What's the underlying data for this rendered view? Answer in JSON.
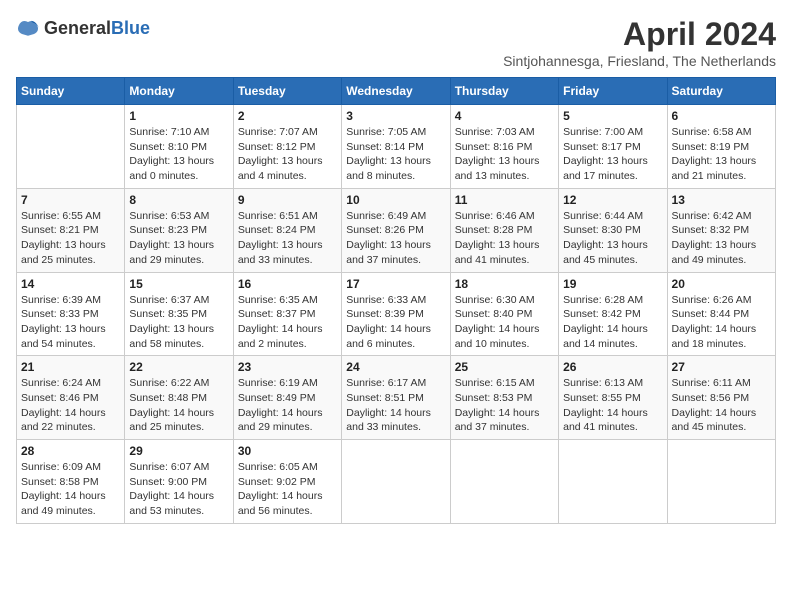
{
  "header": {
    "logo_general": "General",
    "logo_blue": "Blue",
    "month_year": "April 2024",
    "location": "Sintjohannesga, Friesland, The Netherlands"
  },
  "days_of_week": [
    "Sunday",
    "Monday",
    "Tuesday",
    "Wednesday",
    "Thursday",
    "Friday",
    "Saturday"
  ],
  "weeks": [
    [
      {
        "day": null,
        "info": null
      },
      {
        "day": "1",
        "info": "Sunrise: 7:10 AM\nSunset: 8:10 PM\nDaylight: 13 hours\nand 0 minutes."
      },
      {
        "day": "2",
        "info": "Sunrise: 7:07 AM\nSunset: 8:12 PM\nDaylight: 13 hours\nand 4 minutes."
      },
      {
        "day": "3",
        "info": "Sunrise: 7:05 AM\nSunset: 8:14 PM\nDaylight: 13 hours\nand 8 minutes."
      },
      {
        "day": "4",
        "info": "Sunrise: 7:03 AM\nSunset: 8:16 PM\nDaylight: 13 hours\nand 13 minutes."
      },
      {
        "day": "5",
        "info": "Sunrise: 7:00 AM\nSunset: 8:17 PM\nDaylight: 13 hours\nand 17 minutes."
      },
      {
        "day": "6",
        "info": "Sunrise: 6:58 AM\nSunset: 8:19 PM\nDaylight: 13 hours\nand 21 minutes."
      }
    ],
    [
      {
        "day": "7",
        "info": "Sunrise: 6:55 AM\nSunset: 8:21 PM\nDaylight: 13 hours\nand 25 minutes."
      },
      {
        "day": "8",
        "info": "Sunrise: 6:53 AM\nSunset: 8:23 PM\nDaylight: 13 hours\nand 29 minutes."
      },
      {
        "day": "9",
        "info": "Sunrise: 6:51 AM\nSunset: 8:24 PM\nDaylight: 13 hours\nand 33 minutes."
      },
      {
        "day": "10",
        "info": "Sunrise: 6:49 AM\nSunset: 8:26 PM\nDaylight: 13 hours\nand 37 minutes."
      },
      {
        "day": "11",
        "info": "Sunrise: 6:46 AM\nSunset: 8:28 PM\nDaylight: 13 hours\nand 41 minutes."
      },
      {
        "day": "12",
        "info": "Sunrise: 6:44 AM\nSunset: 8:30 PM\nDaylight: 13 hours\nand 45 minutes."
      },
      {
        "day": "13",
        "info": "Sunrise: 6:42 AM\nSunset: 8:32 PM\nDaylight: 13 hours\nand 49 minutes."
      }
    ],
    [
      {
        "day": "14",
        "info": "Sunrise: 6:39 AM\nSunset: 8:33 PM\nDaylight: 13 hours\nand 54 minutes."
      },
      {
        "day": "15",
        "info": "Sunrise: 6:37 AM\nSunset: 8:35 PM\nDaylight: 13 hours\nand 58 minutes."
      },
      {
        "day": "16",
        "info": "Sunrise: 6:35 AM\nSunset: 8:37 PM\nDaylight: 14 hours\nand 2 minutes."
      },
      {
        "day": "17",
        "info": "Sunrise: 6:33 AM\nSunset: 8:39 PM\nDaylight: 14 hours\nand 6 minutes."
      },
      {
        "day": "18",
        "info": "Sunrise: 6:30 AM\nSunset: 8:40 PM\nDaylight: 14 hours\nand 10 minutes."
      },
      {
        "day": "19",
        "info": "Sunrise: 6:28 AM\nSunset: 8:42 PM\nDaylight: 14 hours\nand 14 minutes."
      },
      {
        "day": "20",
        "info": "Sunrise: 6:26 AM\nSunset: 8:44 PM\nDaylight: 14 hours\nand 18 minutes."
      }
    ],
    [
      {
        "day": "21",
        "info": "Sunrise: 6:24 AM\nSunset: 8:46 PM\nDaylight: 14 hours\nand 22 minutes."
      },
      {
        "day": "22",
        "info": "Sunrise: 6:22 AM\nSunset: 8:48 PM\nDaylight: 14 hours\nand 25 minutes."
      },
      {
        "day": "23",
        "info": "Sunrise: 6:19 AM\nSunset: 8:49 PM\nDaylight: 14 hours\nand 29 minutes."
      },
      {
        "day": "24",
        "info": "Sunrise: 6:17 AM\nSunset: 8:51 PM\nDaylight: 14 hours\nand 33 minutes."
      },
      {
        "day": "25",
        "info": "Sunrise: 6:15 AM\nSunset: 8:53 PM\nDaylight: 14 hours\nand 37 minutes."
      },
      {
        "day": "26",
        "info": "Sunrise: 6:13 AM\nSunset: 8:55 PM\nDaylight: 14 hours\nand 41 minutes."
      },
      {
        "day": "27",
        "info": "Sunrise: 6:11 AM\nSunset: 8:56 PM\nDaylight: 14 hours\nand 45 minutes."
      }
    ],
    [
      {
        "day": "28",
        "info": "Sunrise: 6:09 AM\nSunset: 8:58 PM\nDaylight: 14 hours\nand 49 minutes."
      },
      {
        "day": "29",
        "info": "Sunrise: 6:07 AM\nSunset: 9:00 PM\nDaylight: 14 hours\nand 53 minutes."
      },
      {
        "day": "30",
        "info": "Sunrise: 6:05 AM\nSunset: 9:02 PM\nDaylight: 14 hours\nand 56 minutes."
      },
      {
        "day": null,
        "info": null
      },
      {
        "day": null,
        "info": null
      },
      {
        "day": null,
        "info": null
      },
      {
        "day": null,
        "info": null
      }
    ]
  ]
}
